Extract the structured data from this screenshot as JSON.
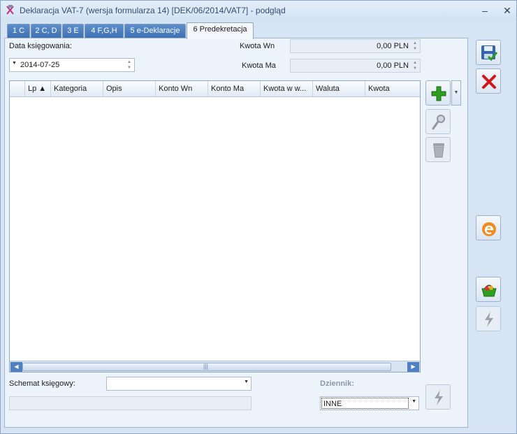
{
  "window": {
    "title": "Deklaracja VAT-7 (wersja formularza 14) [DEK/06/2014/VAT7] - podgląd",
    "minimize_glyph": "–",
    "close_glyph": "✕"
  },
  "tabs": [
    {
      "label": "1 C"
    },
    {
      "label": "2 C, D"
    },
    {
      "label": "3 E"
    },
    {
      "label": "4 F,G,H"
    },
    {
      "label": "5 e-Deklaracje"
    },
    {
      "label": "6 Predekretacja",
      "active": true
    }
  ],
  "form": {
    "date_label": "Data księgowania:",
    "date_value": "2014-07-25",
    "kwota_wn_label": "Kwota Wn",
    "kwota_wn_value": "0,00 PLN",
    "kwota_ma_label": "Kwota Ma",
    "kwota_ma_value": "0,00 PLN",
    "schemat_label": "Schemat księgowy:",
    "schemat_value": "",
    "dziennik_label": "Dziennik:",
    "dziennik_value": "INNE"
  },
  "grid": {
    "columns": [
      "",
      "Lp ▲",
      "Kategoria",
      "Opis",
      "Konto Wn",
      "Konto Ma",
      "Kwota w w...",
      "Waluta",
      "Kwota"
    ],
    "rows": [],
    "scroll_thumb_glyph": "|||"
  },
  "icons": {
    "app": "vat-document-icon",
    "add": "plus-icon",
    "edit": "magnifier-icon",
    "delete": "trash-icon",
    "save": "save-icon",
    "cancel": "cancel-icon",
    "edeclaration": "e-declaration-icon",
    "basket": "basket-icon",
    "lightning": "lightning-icon"
  },
  "colors": {
    "accent": "#3c6fb1",
    "panel_bg": "#edf3fa",
    "window_bg": "#d6e4f4",
    "add_green": "#2e9e1f",
    "cancel_red": "#d01818"
  }
}
